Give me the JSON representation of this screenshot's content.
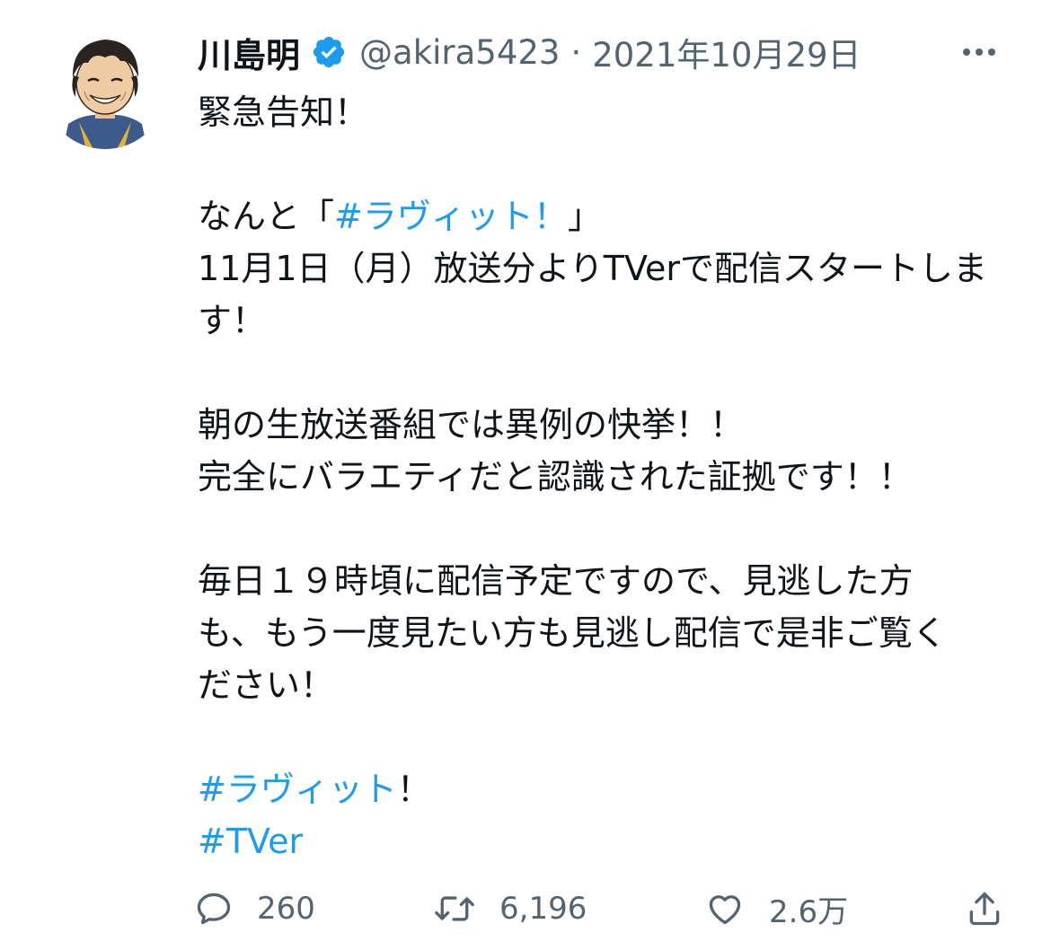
{
  "user": {
    "display_name": "川島明",
    "handle": "@akira5423",
    "separator": "·",
    "date": "2021年10月29日",
    "verified": true,
    "verified_color": "#1d9bf0"
  },
  "tweet": {
    "line1": "緊急告知！",
    "line2_prefix": "なんと「",
    "line2_hashtag": "#ラヴィット！",
    "line2_suffix": "」",
    "line3": "11月1日（月）放送分よりTVerで配信スタートしま",
    "line4": "す！",
    "line5": "朝の生放送番組では異例の快挙！！",
    "line6": "完全にバラエティだと認識された証拠です！！",
    "line7": "毎日１９時頃に配信予定ですので、見逃した方",
    "line8": "も、もう一度見たい方も見逃し配信で是非ご覧く",
    "line9": "ださい！",
    "hashtag1": "#ラヴィット",
    "hashtag1_suffix": "！",
    "hashtag2": "#TVer"
  },
  "actions": {
    "reply_count": "260",
    "retweet_count": "6,196",
    "like_count": "2.6万"
  },
  "icons": {
    "avatar": "avatar-illustration",
    "verified": "verified-badge-icon",
    "more": "more-icon",
    "reply": "reply-icon",
    "retweet": "retweet-icon",
    "like": "like-icon",
    "share": "share-icon"
  },
  "colors": {
    "text": "#0f1419",
    "secondary": "#536471",
    "link": "#1d9bf0"
  }
}
